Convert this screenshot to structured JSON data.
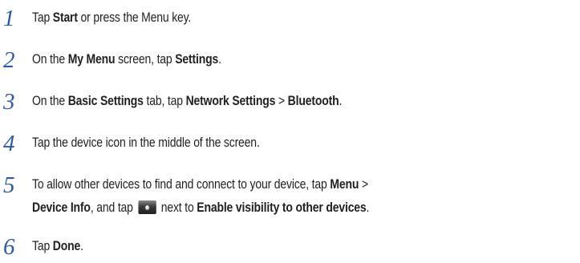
{
  "steps": [
    {
      "number": "1",
      "parts": [
        {
          "t": "Tap "
        },
        {
          "t": "Start",
          "b": true
        },
        {
          "t": " or press the Menu key."
        }
      ]
    },
    {
      "number": "2",
      "parts": [
        {
          "t": "On the "
        },
        {
          "t": "My Menu",
          "b": true
        },
        {
          "t": " screen, tap "
        },
        {
          "t": "Settings",
          "b": true
        },
        {
          "t": "."
        }
      ]
    },
    {
      "number": "3",
      "parts": [
        {
          "t": "On the "
        },
        {
          "t": "Basic Settings",
          "b": true
        },
        {
          "t": " tab, tap "
        },
        {
          "t": "Network Settings",
          "b": true
        },
        {
          "t": " > "
        },
        {
          "t": "Bluetooth",
          "b": true
        },
        {
          "t": "."
        }
      ]
    },
    {
      "number": "4",
      "parts": [
        {
          "t": "Tap the device icon in the middle of the screen."
        }
      ]
    },
    {
      "number": "5",
      "parts": [
        {
          "t": "To allow other devices to find and connect to your device, tap "
        },
        {
          "t": "Menu",
          "b": true
        },
        {
          "t": " >"
        },
        {
          "br": true
        },
        {
          "t": "Device Info",
          "b": true
        },
        {
          "t": ", and tap "
        },
        {
          "icon": "visibility-toggle-icon"
        },
        {
          "t": " next to "
        },
        {
          "t": "Enable visibility to other devices",
          "b": true
        },
        {
          "t": "."
        }
      ]
    },
    {
      "number": "6",
      "parts": [
        {
          "t": "Tap "
        },
        {
          "t": "Done",
          "b": true
        },
        {
          "t": "."
        }
      ]
    }
  ]
}
